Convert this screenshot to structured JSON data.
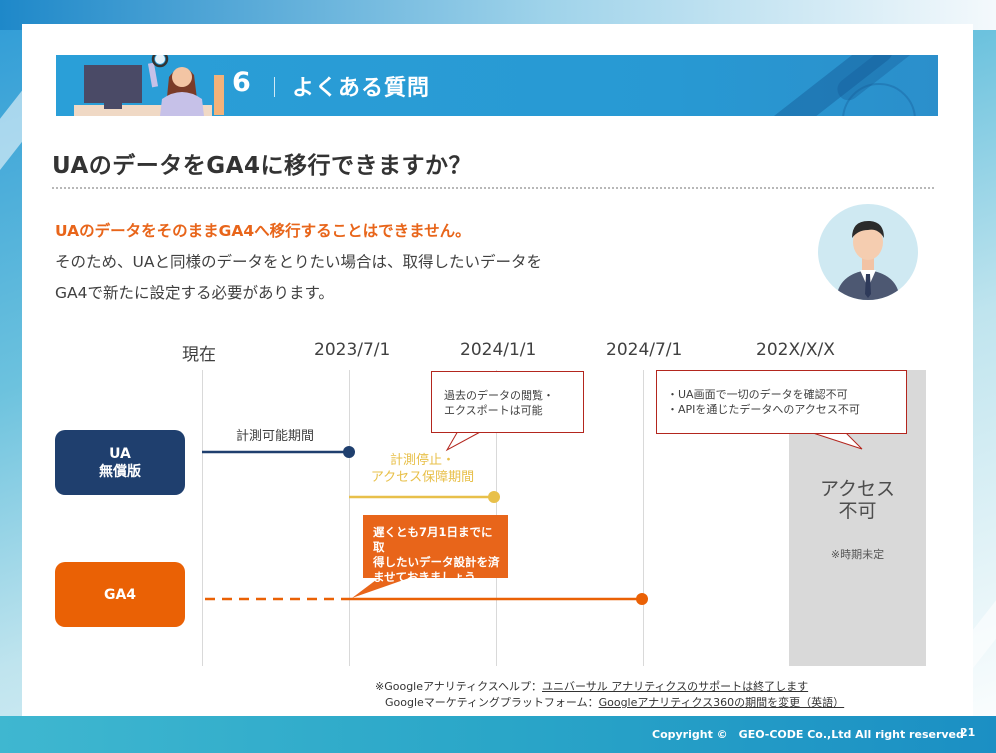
{
  "section": {
    "number": "6",
    "title": "よくある質問"
  },
  "page_title": "UAのデータをGA4に移行できますか？",
  "lead": {
    "highlight": "UAのデータをそのままGA4へ移行することはできません。",
    "line1": "そのため、UAと同様のデータをとりたい場合は、取得したいデータを",
    "line2": "GA4で新たに設定する必要があります。"
  },
  "timeline": {
    "headers": [
      "現在",
      "2023/7/1",
      "2024/1/1",
      "2024/7/1",
      "202X/X/X"
    ],
    "ua_label_line1": "UA",
    "ua_label_line2": "無償版",
    "ga4_label": "GA4",
    "measure_label": "計測可能期間",
    "stop_label_line1": "計測停止・",
    "stop_label_line2": "アクセス保障期間",
    "callout1_line1": "過去のデータの閲覧・",
    "callout1_line2": "エクスポートは可能",
    "callout2_line1": "・UA画面で一切のデータを確認不可",
    "callout2_line2": "・APIを通じたデータへのアクセス不可",
    "orange_line1": "遅くとも7月1日までに取",
    "orange_line2": "得したいデータ設計を済",
    "orange_line3": "ませておきましょう",
    "no_access_line1": "アクセス",
    "no_access_line2": "不可",
    "no_access_note": "※時期未定"
  },
  "sources": {
    "line1_prefix": "※Googleアナリティクスヘルプ：",
    "line1_link": "ユニバーサル アナリティクスのサポートは終了します",
    "line2_prefix": "Googleマーケティングプラットフォーム：",
    "line2_link": "Googleアナリティクス360の期間を変更（英語）"
  },
  "footer": {
    "copyright": "Copyright ©　GEO-CODE Co.,Ltd All right reserved",
    "page": "21"
  },
  "colors": {
    "ua": "#1f3f6e",
    "ga4": "#ea6105",
    "stop": "#e8c04a",
    "callout_border": "#b3261e",
    "header": "#2a9fd8"
  }
}
